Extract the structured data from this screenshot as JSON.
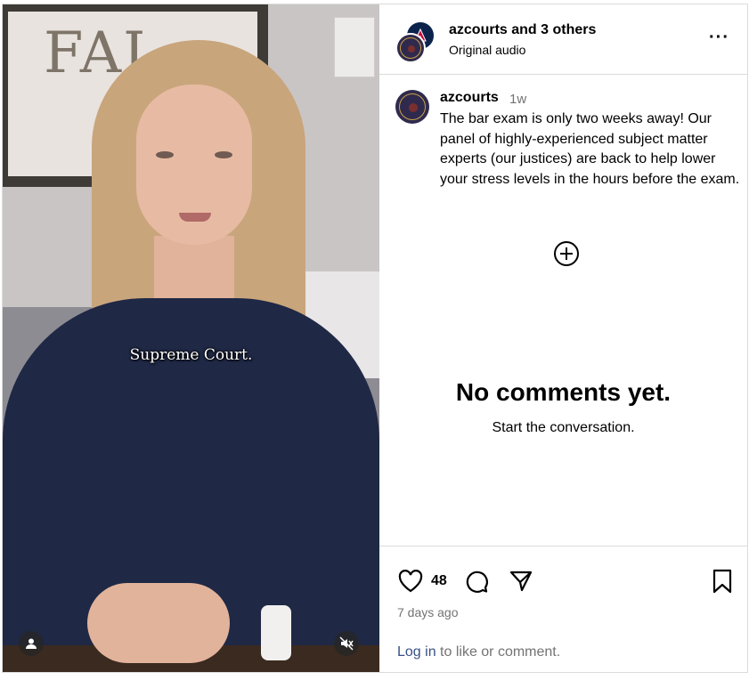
{
  "media": {
    "caption": "Supreme Court.",
    "art_text": "FAI",
    "icons": {
      "user": "user-tag-icon",
      "audio": "muted-speaker-icon"
    }
  },
  "header": {
    "username": "azcourts",
    "collab": "and 3 others",
    "audio": "Original audio",
    "more_icon": "more-dots-icon"
  },
  "post": {
    "username": "azcourts",
    "time": "1w",
    "body": "The bar exam is only two weeks away! Our panel of highly-experienced subject matter experts (our justices) are back to help lower your stress levels in the hours before the exam.",
    "expand_icon": "plus-circle-icon"
  },
  "comments": {
    "empty_title": "No comments yet.",
    "empty_sub": "Start the conversation."
  },
  "actions": {
    "likes": "48",
    "ago": "7 days ago",
    "login_link": "Log in",
    "login_rest": " to like or comment.",
    "icons": [
      "heart-icon",
      "comment-icon",
      "share-icon",
      "bookmark-icon"
    ]
  },
  "colors": {
    "link": "#385185",
    "muted": "#737373",
    "border": "#dbdbdb"
  }
}
